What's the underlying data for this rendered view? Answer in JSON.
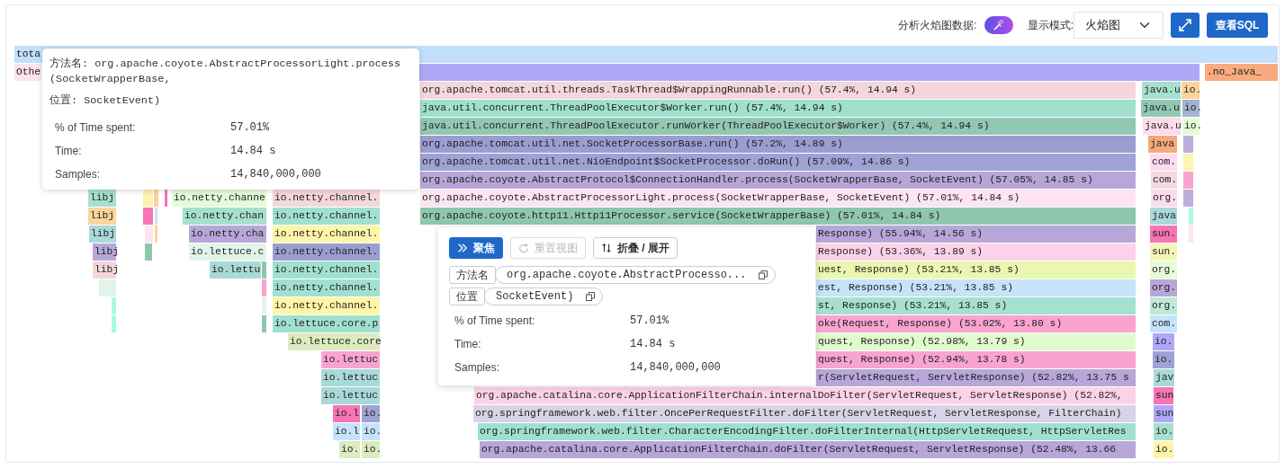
{
  "toolbar": {
    "analyze_label": "分析火焰图数据:",
    "mode_label": "显示模式:",
    "mode_value": "火焰图",
    "sql_button": "查看SQL"
  },
  "rows": [
    {
      "frames": [
        {
          "label": "tota",
          "color": "#c2dffb"
        }
      ]
    },
    {
      "frames": [
        {
          "label": "Othe",
          "color": "#fde4ec"
        },
        {
          "color": "#b0a8f7"
        },
        {
          "label": ".no_Java_",
          "color": "#f9ab7f"
        }
      ]
    },
    {
      "frames": [
        {
          "label": "org.apache.tomcat.util.threads.TaskThread$WrappingRunnable.run() (57.4%, 14.94 s)",
          "color": "#f4d6db"
        },
        {
          "label": "java.u",
          "color": "#a6e0cf"
        },
        {
          "label": "io.",
          "color": "#fbd69a"
        }
      ]
    },
    {
      "frames": [
        {
          "label": "java.util.concurrent.ThreadPoolExecutor$Worker.run() (57.4%, 14.94 s)",
          "color": "#a0e0cf"
        },
        {
          "label": "java.u",
          "color": "#91c8b3"
        },
        {
          "label": "io.",
          "color": "#a3b3d0"
        }
      ]
    },
    {
      "frames": [
        {
          "label": "java.util.concurrent.ThreadPoolExecutor.runWorker(ThreadPoolExecutor$Worker) (57.4%, 14.94 s)",
          "color": "#92c8b2"
        },
        {
          "label": "java.u",
          "color": "#fcdcec"
        },
        {
          "label": "io.",
          "color": "#e5fbd9"
        }
      ]
    },
    {
      "frames": [
        {
          "label": "org.apache.tomcat.util.net.SocketProcessorBase.run() (57.2%, 14.89 s)",
          "color": "#9b9dd1"
        },
        {
          "label": "java",
          "color": "#f7a97a"
        },
        {
          "color": "#bdaede"
        }
      ]
    },
    {
      "frames": [
        {
          "label": "org.apache.tomcat.util.net.NioEndpoint$SocketProcessor.doRun() (57.09%, 14.86 s)",
          "color": "#9da3d4"
        },
        {
          "label": "com.",
          "color": "#fcdcee"
        },
        {
          "color": "#fcf6b0"
        }
      ]
    },
    {
      "frames": [
        {
          "label": "org.apache.coyote.AbstractProtocol$ConnectionHandler.process(SocketWrapperBase, SocketEvent) (57.05%, 14.85 s)",
          "color": "#b7a7d9"
        },
        {
          "label": "com.",
          "color": "#f4d9de"
        },
        {
          "color": "#f9a4d0"
        }
      ]
    },
    {
      "frames": [
        {
          "label": "libj",
          "color": "#a6e0cf"
        },
        {
          "color": "#fdf3b0"
        },
        {
          "color": "#fad39a"
        },
        {
          "color": "#f774b5"
        },
        {
          "label": "io.netty.channe",
          "color": "#e4fbd9"
        },
        {
          "label": "io.netty.channel.",
          "color": "#f4d6db"
        },
        {
          "label": "org.apache.coyote.AbstractProcessorLight.process(SocketWrapperBase, SocketEvent) (57.01%, 14.84 s)",
          "color": "#fde4f0"
        },
        {
          "label": "org.",
          "color": "#fcdcee"
        },
        {
          "color": "#bdaede"
        }
      ]
    },
    {
      "frames": [
        {
          "label": "libj",
          "color": "#fbd69a"
        },
        {
          "color": "#f774b5"
        },
        {
          "color": "#c5e3fb"
        },
        {
          "label": "io.netty.chan",
          "color": "#a6e0cf"
        },
        {
          "label": "io.netty.channel.",
          "color": "#a0e0cf"
        },
        {
          "label": "org.apache.coyote.http11.Http11Processor.service(SocketWrapperBase) (57.01%, 14.84 s)",
          "color": "#8fc7ae"
        },
        {
          "label": "java",
          "color": "#a9d9d9"
        },
        {
          "color": "#a7fbe4"
        }
      ]
    },
    {
      "frames": [
        {
          "label": "libj",
          "color": "#a9d9d9"
        },
        {
          "color": "#fde4f0"
        },
        {
          "color": "#fad39a"
        },
        {
          "label": "io.netty.cha",
          "color": "#b7a7d9"
        },
        {
          "label": "io.netty.channel.",
          "color": "#fdf6a8"
        },
        {
          "label": "Response) (55.94%, 14.56 s)",
          "color": "#b7a7d9"
        },
        {
          "label": "sun.",
          "color": "#f774b5"
        },
        {
          "color": "#fde4f0"
        }
      ]
    },
    {
      "frames": [
        {
          "label": "libj",
          "color": "#b7a7d9"
        },
        {
          "color": "#8fc7ae"
        },
        {
          "label": "io.lettuce.c",
          "color": "#e0f5e8"
        },
        {
          "label": "io.netty.channel.",
          "color": "#9b9dd1"
        },
        {
          "label": "Response) (53.36%, 13.89 s)",
          "color": "#fbd2e8"
        },
        {
          "label": "sun.",
          "color": "#f3f7b8"
        }
      ]
    },
    {
      "frames": [
        {
          "label": "libj",
          "color": "#f4d6db"
        },
        {
          "label": "io.lettu",
          "color": "#a9d9d9"
        },
        {
          "color": "#8fc7ae"
        },
        {
          "label": "io.netty.channel.",
          "color": "#a0e0cf"
        },
        {
          "label": "uest, Response) (53.21%, 13.85 s)",
          "color": "#eaf7b0"
        },
        {
          "label": "org.",
          "color": "#e5fbd9"
        }
      ]
    },
    {
      "frames": [
        {
          "color": "#e0f5e8"
        },
        {
          "color": "#f9a4d0"
        },
        {
          "label": "io.netty.channel.",
          "color": "#a0e0cf"
        },
        {
          "label": "est, Response) (53.21%, 13.85 s)",
          "color": "#c5e3fb"
        },
        {
          "label": "org.",
          "color": "#b7a7d9"
        }
      ]
    },
    {
      "frames": [
        {
          "color": "#a7fbe4"
        },
        {
          "color": "#e0f5e8"
        },
        {
          "label": "io.netty.channel.",
          "color": "#fdf6a8"
        },
        {
          "label": "st, Response) (53.21%, 13.85 s)",
          "color": "#a6e0cf"
        },
        {
          "label": "org.",
          "color": "#bde9d6"
        }
      ]
    },
    {
      "frames": [
        {
          "color": "#a7fbe4"
        },
        {
          "color": "#8fc7ae"
        },
        {
          "label": "io.lettuce.core.p",
          "color": "#a0e0cf"
        },
        {
          "label": "oke(Request, Response) (53.02%, 13.80 s)",
          "color": "#f9a4d0"
        },
        {
          "label": "com.",
          "color": "#c5e3fb"
        }
      ]
    },
    {
      "frames": [
        {
          "label": "io.lettuce.core",
          "color": "#dcebc0"
        },
        {
          "label": "quest, Response) (52.98%, 13.79 s)",
          "color": "#e0fbcd"
        },
        {
          "label": "io.",
          "color": "#b0a8f7"
        }
      ]
    },
    {
      "frames": [
        {
          "label": "io.lettuc",
          "color": "#f9a4d0"
        },
        {
          "label": "quest, Response) (52.94%, 13.78 s)",
          "color": "#f9a4d0"
        },
        {
          "label": "io.",
          "color": "#9da3d4"
        }
      ]
    },
    {
      "frames": [
        {
          "label": "io.lettuc",
          "color": "#a9d9d9"
        },
        {
          "label": "r(ServletRequest, ServletResponse) (52.82%, 13.75 s",
          "color": "#b7a7d9"
        },
        {
          "label": "jav",
          "color": "#a9d9d9"
        }
      ]
    },
    {
      "frames": [
        {
          "label": "io.lettuc",
          "color": "#a9d9d9"
        },
        {
          "label": "org.apache.catalina.core.ApplicationFilterChain.internalDoFilter(ServletRequest, ServletResponse) (52.82%,",
          "color": "#fbd2e8"
        },
        {
          "label": "sun",
          "color": "#f774b5"
        }
      ]
    },
    {
      "frames": [
        {
          "label": "io.l",
          "color": "#f774b5"
        },
        {
          "label": "io.",
          "color": "#9da3d4"
        },
        {
          "label": "org.springframework.web.filter.OncePerRequestFilter.doFilter(ServletRequest, ServletResponse, FilterChain)",
          "color": "#d8d3e6"
        },
        {
          "label": "sun",
          "color": "#b0a8f7"
        }
      ]
    },
    {
      "frames": [
        {
          "label": "io.l",
          "color": "#c5e3fb"
        },
        {
          "label": "io.",
          "color": "#c5e3fb"
        },
        {
          "label": "org.springframework.web.filter.CharacterEncodingFilter.doFilterInternal(HttpServletRequest, HttpServletRes",
          "color": "#a0e0cf"
        },
        {
          "label": "io.",
          "color": "#a6e0cf"
        }
      ]
    },
    {
      "frames": [
        {
          "label": "io.",
          "color": "#dcebc0"
        },
        {
          "label": "io.",
          "color": "#dcebc0"
        },
        {
          "label": "org.apache.catalina.core.ApplicationFilterChain.doFilter(ServletRequest, ServletResponse) (52.48%, 13.66",
          "color": "#b7a7d9"
        },
        {
          "label": "io.",
          "color": "#fdf6a8"
        }
      ]
    }
  ],
  "hover_tooltip": {
    "method_lines": [
      "方法名: org.apache.coyote.AbstractProcessorLight.process",
      "(SocketWrapperBase,"
    ],
    "location": "位置: SocketEvent)",
    "stats": [
      {
        "label": "% of Time spent:",
        "value": "57.01%"
      },
      {
        "label": "Time:",
        "value": "14.84 s"
      },
      {
        "label": "Samples:",
        "value": "14,840,000,000"
      }
    ]
  },
  "context_menu": {
    "buttons": [
      {
        "label": "聚焦",
        "kind": "focus",
        "disabled": false
      },
      {
        "label": "重置视图",
        "kind": "reset",
        "disabled": true
      },
      {
        "label": "折叠 / 展开",
        "kind": "fold",
        "disabled": false
      }
    ],
    "tags": [
      {
        "key": "方法名",
        "value": "org.apache.coyote.AbstractProcesso..."
      },
      {
        "key": "位置",
        "value": "SocketEvent)"
      }
    ],
    "stats": [
      {
        "label": "% of Time spent:",
        "value": "57.01%"
      },
      {
        "label": "Time:",
        "value": "14.84 s"
      },
      {
        "label": "Samples:",
        "value": "14,840,000,000"
      }
    ]
  }
}
